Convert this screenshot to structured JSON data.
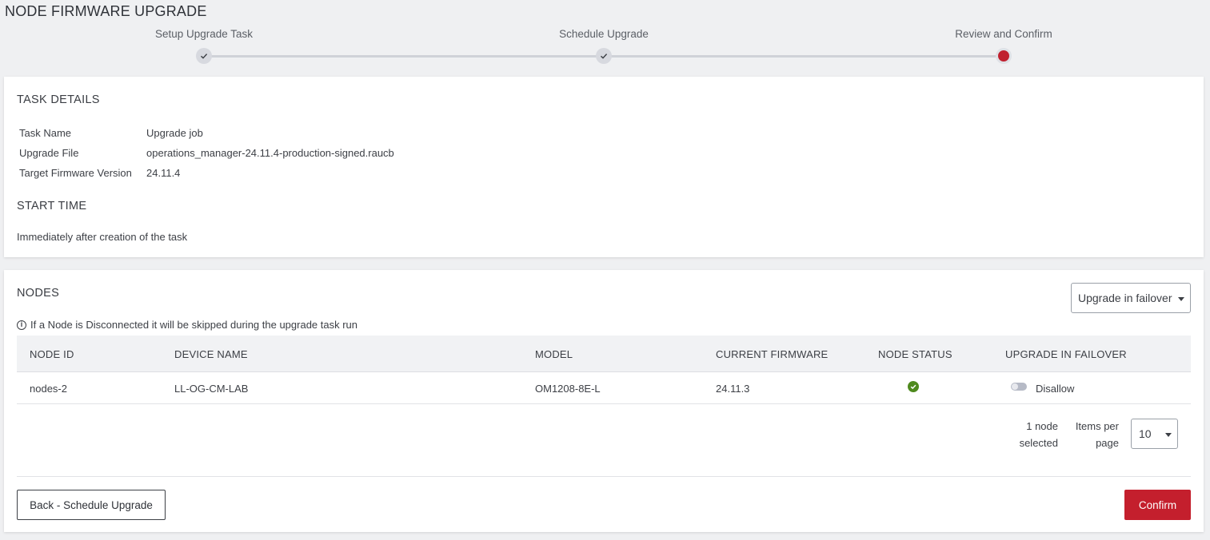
{
  "page": {
    "title": "NODE FIRMWARE UPGRADE"
  },
  "stepper": {
    "steps": [
      {
        "label": "Setup Upgrade Task",
        "state": "done"
      },
      {
        "label": "Schedule Upgrade",
        "state": "done"
      },
      {
        "label": "Review and Confirm",
        "state": "current"
      }
    ]
  },
  "task_details": {
    "title": "TASK DETAILS",
    "fields": [
      {
        "label": "Task Name",
        "value": "Upgrade job"
      },
      {
        "label": "Upgrade File",
        "value": "operations_manager-24.11.4-production-signed.raucb"
      },
      {
        "label": "Target Firmware Version",
        "value": "24.11.4"
      }
    ]
  },
  "start_time": {
    "title": "START TIME",
    "value": "Immediately after creation of the task"
  },
  "nodes": {
    "title": "NODES",
    "failover_dropdown": {
      "selected": "Upgrade in failover"
    },
    "info_text": "If a Node is Disconnected it will be skipped during the upgrade task run",
    "columns": [
      "NODE ID",
      "DEVICE NAME",
      "MODEL",
      "CURRENT FIRMWARE",
      "NODE STATUS",
      "UPGRADE IN FAILOVER"
    ],
    "rows": [
      {
        "node_id": "nodes-2",
        "device_name": "LL-OG-CM-LAB",
        "model": "OM1208-8E-L",
        "current_firmware": "24.11.3",
        "node_status": "connected",
        "failover_toggle": "Disallow"
      }
    ],
    "pagination": {
      "selected_line1": "1 node",
      "selected_line2": "selected",
      "items_per_page_line1": "Items per",
      "items_per_page_line2": "page",
      "items_per_page_value": "10"
    }
  },
  "actions": {
    "back_label": "Back - Schedule Upgrade",
    "confirm_label": "Confirm"
  },
  "colors": {
    "accent": "#c41f2d",
    "status_ok": "#4f8a1e",
    "background": "#eff0f2"
  }
}
